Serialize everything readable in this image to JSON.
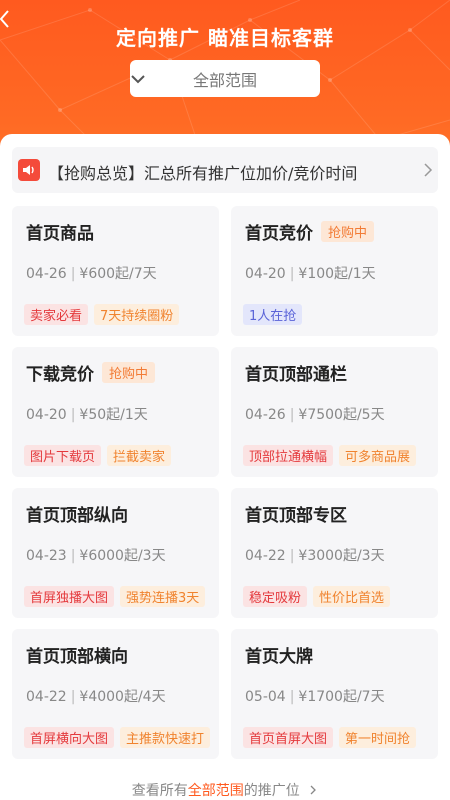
{
  "header": {
    "title": "定向推广  瞄准目标客群",
    "scope_value": "全部范围"
  },
  "notice": {
    "text": "【抢购总览】汇总所有推广位加价/竞价时间"
  },
  "cards": [
    {
      "name": "首页商品",
      "status": "",
      "date": "04-26",
      "price": "¥600起/7天",
      "tags": [
        {
          "text": "卖家必看",
          "color": "red"
        },
        {
          "text": "7天持续圈粉",
          "color": "orange"
        }
      ]
    },
    {
      "name": "首页竞价",
      "status": "抢购中",
      "date": "04-20",
      "price": "¥100起/1天",
      "tags": [
        {
          "text": "1人在抢",
          "color": "blue"
        }
      ]
    },
    {
      "name": "下载竞价",
      "status": "抢购中",
      "date": "04-20",
      "price": "¥50起/1天",
      "tags": [
        {
          "text": "图片下载页",
          "color": "red"
        },
        {
          "text": "拦截卖家",
          "color": "orange"
        }
      ]
    },
    {
      "name": "首页顶部通栏",
      "status": "",
      "date": "04-26",
      "price": "¥7500起/5天",
      "tags": [
        {
          "text": "顶部拉通横幅",
          "color": "red"
        },
        {
          "text": "可多商品展",
          "color": "orange"
        }
      ]
    },
    {
      "name": "首页顶部纵向",
      "status": "",
      "date": "04-23",
      "price": "¥6000起/3天",
      "tags": [
        {
          "text": "首屏独播大图",
          "color": "red"
        },
        {
          "text": "强势连播3天",
          "color": "orange"
        }
      ]
    },
    {
      "name": "首页顶部专区",
      "status": "",
      "date": "04-22",
      "price": "¥3000起/3天",
      "tags": [
        {
          "text": "稳定吸粉",
          "color": "red"
        },
        {
          "text": "性价比首选",
          "color": "orange"
        }
      ]
    },
    {
      "name": "首页顶部横向",
      "status": "",
      "date": "04-22",
      "price": "¥4000起/4天",
      "tags": [
        {
          "text": "首屏横向大图",
          "color": "red"
        },
        {
          "text": "主推款快速打",
          "color": "orange"
        }
      ]
    },
    {
      "name": "首页大牌",
      "status": "",
      "date": "05-04",
      "price": "¥1700起/7天",
      "tags": [
        {
          "text": "首页首屏大图",
          "color": "red"
        },
        {
          "text": "第一时间抢",
          "color": "orange"
        }
      ]
    }
  ],
  "footer": {
    "prefix": "查看所有",
    "highlight": "全部范围",
    "suffix": "的推广位"
  },
  "colors": {
    "brand": "#ff5a1f",
    "tag_red": "#e4393c",
    "tag_orange": "#f0832e",
    "tag_blue": "#5a63d8"
  }
}
